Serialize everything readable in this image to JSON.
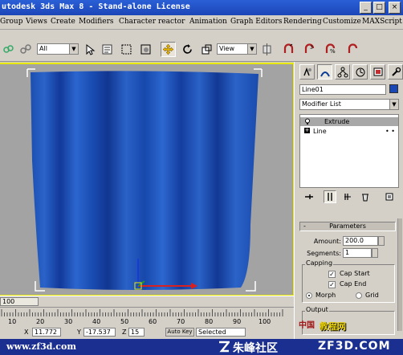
{
  "window": {
    "title": "utodesk 3ds Max 8  - Stand-alone License",
    "minimize_glyph": "_",
    "maximize_glyph": "□",
    "close_glyph": "×"
  },
  "menu": [
    "Group",
    "Views",
    "Create",
    "Modifiers",
    "Character",
    "reactor",
    "Animation",
    "Graph Editors",
    "Rendering",
    "Customize",
    "MAXScript"
  ],
  "toolbar": {
    "selection_filter": "All",
    "reference_coord": "View",
    "dropdown_arrow": "▼",
    "icons": [
      "link-icon",
      "unlink-icon",
      "selection-filter-dropdown",
      "select-arrow-icon",
      "select-by-name-icon",
      "rectangle-region-icon",
      "window-crossing-icon",
      "move-icon",
      "rotate-icon",
      "scale-icon",
      "reference-coord-dropdown",
      "pivot-icon",
      "snap-icon",
      "angle-snap-icon",
      "percent-snap-icon"
    ]
  },
  "command_panel": {
    "tabs": [
      "create-tab-icon",
      "modify-tab-icon",
      "hierarchy-tab-icon",
      "motion-tab-icon",
      "display-tab-icon",
      "utilities-tab-icon"
    ],
    "object_name": "Line01",
    "object_color": "#1a49b5",
    "modifier_list": "Modifier List",
    "stack": [
      {
        "label": "Extrude",
        "selected": true
      },
      {
        "label": "Line",
        "selected": false
      }
    ],
    "stack_glyphs": {
      "expand": "+",
      "dots": "• •"
    },
    "parameters": {
      "title": "Parameters",
      "collapse_glyph": "-",
      "amount_label": "Amount:",
      "amount": "200.0",
      "segments_label": "Segments:",
      "segments": "1",
      "capping_title": "Capping",
      "cap_start": "Cap Start",
      "cap_start_checked": true,
      "cap_end": "Cap End",
      "cap_end_checked": true,
      "check_glyph": "✓",
      "morph": "Morph",
      "grid": "Grid",
      "capping_mode": "Morph",
      "output_title": "Output"
    }
  },
  "timeline": {
    "slider_text": "100",
    "ticks": [
      "10",
      "20",
      "30",
      "40",
      "50",
      "60",
      "70",
      "80",
      "90",
      "100"
    ]
  },
  "status": {
    "x_label": "X",
    "x": "11.772",
    "y_label": "Y",
    "y": "-17.537",
    "z_label": "Z",
    "z": "15",
    "autokey": "Auto Key",
    "selected": "Selected"
  },
  "watermark": {
    "url": "www.zf3d.com",
    "cn": "朱峰社区",
    "brand": "ZF3D.COM",
    "overlay_text": "教程网",
    "overlay_text2": "中国"
  }
}
